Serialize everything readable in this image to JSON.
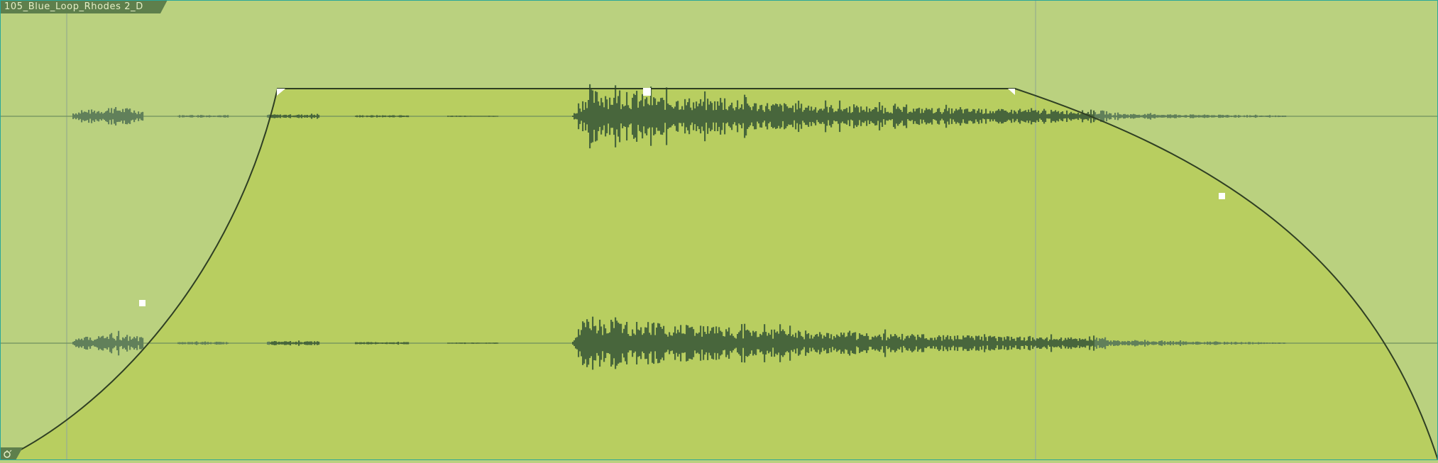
{
  "region": {
    "name": "105_Blue_Loop_Rhodes 2_D"
  },
  "colors": {
    "background": "#bad17f",
    "faded_background": "#bbd282",
    "active_fill": "#b8ce60",
    "waveform": "#48663c",
    "waveform_faded": "#61805a",
    "fade_curve": "#2f3f23",
    "divider": "#9db48a",
    "border": "#2aa89a",
    "handle": "#ffffff",
    "tab": "#5e7f4c"
  },
  "icons": {
    "loop": "loop-icon",
    "fade_in_handle": "fade-in-handle-icon",
    "fade_out_handle": "fade-out-handle-icon"
  }
}
